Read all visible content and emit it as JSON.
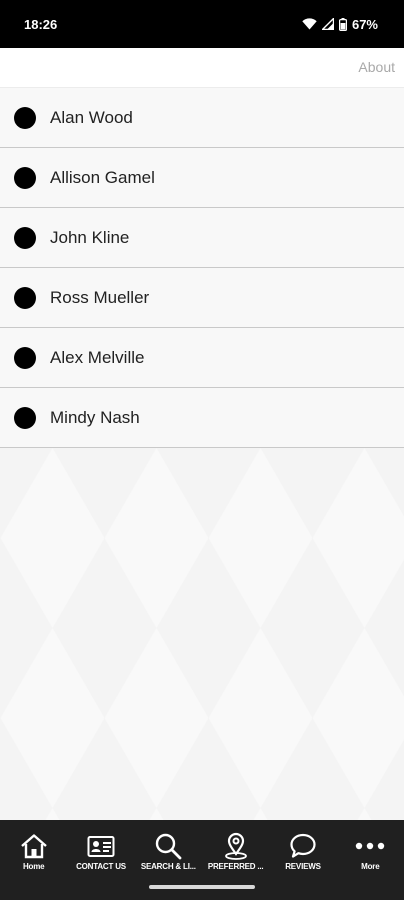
{
  "status_bar": {
    "time": "18:26",
    "battery": "67%",
    "icons": [
      "wifi-icon",
      "cell-signal-icon",
      "battery-icon"
    ]
  },
  "header": {
    "about_label": "About"
  },
  "contacts": [
    {
      "name": "Alan Wood"
    },
    {
      "name": "Allison Gamel"
    },
    {
      "name": "John Kline"
    },
    {
      "name": "Ross Mueller"
    },
    {
      "name": "Alex Melville"
    },
    {
      "name": "Mindy Nash"
    }
  ],
  "bottom_nav": [
    {
      "label": "Home",
      "icon": "home-icon"
    },
    {
      "label": "CONTACT US",
      "icon": "contact-card-icon"
    },
    {
      "label": "SEARCH & LI...",
      "icon": "search-icon"
    },
    {
      "label": "PREFERRED ...",
      "icon": "map-pin-icon"
    },
    {
      "label": "REVIEWS",
      "icon": "chat-bubble-icon"
    },
    {
      "label": "More",
      "icon": "more-dots-icon"
    }
  ],
  "colors": {
    "status_bar_bg": "#000000",
    "nav_bg": "#202020",
    "divider": "#c9c9c9",
    "about_text": "#a9a9a9"
  }
}
